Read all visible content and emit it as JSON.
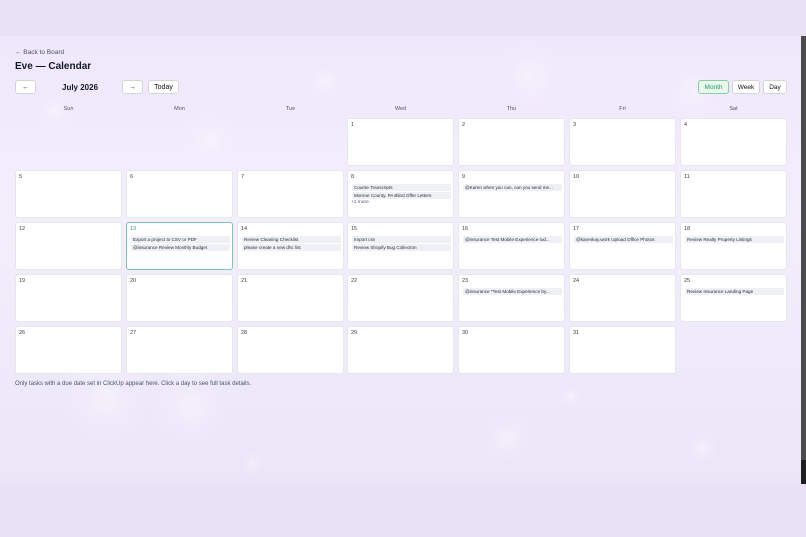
{
  "nav": {
    "back_label": "← Back to Board"
  },
  "page": {
    "title": "Eve — Calendar"
  },
  "toolbar": {
    "prev_label": "←",
    "month_label": "July 2026",
    "next_label": "→",
    "today_label": "Today"
  },
  "views": {
    "month": "Month",
    "week": "Week",
    "day": "Day",
    "active": "Month"
  },
  "weekdays": [
    "Sun",
    "Mon",
    "Tue",
    "Wed",
    "Thu",
    "Fri",
    "Sat"
  ],
  "weeks": [
    [
      null,
      null,
      null,
      {
        "day": "1",
        "tasks": []
      },
      {
        "day": "2",
        "tasks": []
      },
      {
        "day": "3",
        "tasks": []
      },
      {
        "day": "4",
        "tasks": []
      }
    ],
    [
      {
        "day": "5",
        "tasks": []
      },
      {
        "day": "6",
        "tasks": []
      },
      {
        "day": "7",
        "tasks": []
      },
      {
        "day": "8",
        "tasks": [
          "Course Transcripts",
          "Monroe County, PA Blind Offer Letters"
        ],
        "more": "+1 more"
      },
      {
        "day": "9",
        "tasks": [
          "@Karen when you can, can you send me..."
        ]
      },
      {
        "day": "10",
        "tasks": []
      },
      {
        "day": "11",
        "tasks": []
      }
    ],
    [
      {
        "day": "12",
        "tasks": []
      },
      {
        "day": "13",
        "tasks": [
          "Export a project to CSV or PDF",
          "@insurance Review Monthly Budget"
        ],
        "today": true
      },
      {
        "day": "14",
        "tasks": [
          "Review Cleaning Checklist",
          "please create a new dhc list"
        ]
      },
      {
        "day": "15",
        "tasks": [
          "Import csv",
          "Review Shopify Bug Collection"
        ]
      },
      {
        "day": "16",
        "tasks": [
          "@insurance Test Mobile Experience tod..."
        ]
      },
      {
        "day": "17",
        "tasks": [
          "@karenkay.work Upload Office Photos"
        ]
      },
      {
        "day": "18",
        "tasks": [
          "Review Realty Property Listings"
        ]
      }
    ],
    [
      {
        "day": "19",
        "tasks": []
      },
      {
        "day": "20",
        "tasks": []
      },
      {
        "day": "21",
        "tasks": []
      },
      {
        "day": "22",
        "tasks": []
      },
      {
        "day": "23",
        "tasks": [
          "@insurance *Test Mobile Experience by..."
        ]
      },
      {
        "day": "24",
        "tasks": []
      },
      {
        "day": "25",
        "tasks": [
          "Review Insurance Landing Page"
        ]
      }
    ],
    [
      {
        "day": "26",
        "tasks": []
      },
      {
        "day": "27",
        "tasks": []
      },
      {
        "day": "28",
        "tasks": []
      },
      {
        "day": "29",
        "tasks": []
      },
      {
        "day": "30",
        "tasks": []
      },
      {
        "day": "31",
        "tasks": []
      },
      null
    ]
  ],
  "footer": {
    "note": "Only tasks with a due date set in ClickUp appear here. Click a day to see full task details."
  }
}
